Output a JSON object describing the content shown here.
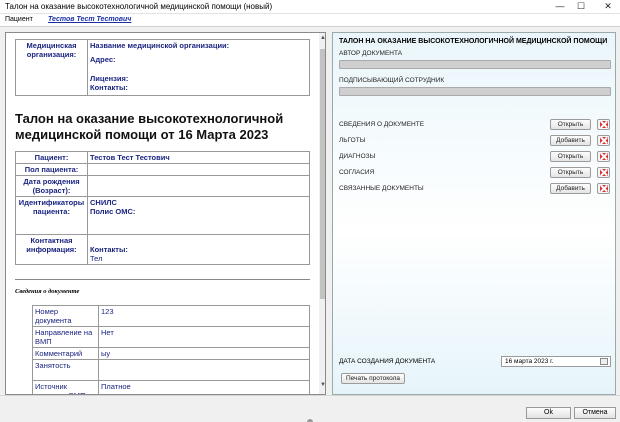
{
  "window": {
    "title": "Талон на оказание высокотехнологичной медицинской помощи (новый)",
    "minimize_glyph": "—",
    "maximize_glyph": "☐",
    "close_glyph": "✕"
  },
  "menubar": {
    "patient_label": "Пациент",
    "patient_name": "Тестов Тест Тестович"
  },
  "document": {
    "org_label": "Медицинская организация:",
    "org_name_label": "Название медицинской организации:",
    "address_label": "Адрес:",
    "license_label": "Лицензия:",
    "contacts_label": "Контакты:",
    "title": "Талон на оказание высокотехнологичной медицинской помощи от 16 Марта 2023",
    "patient_label": "Пациент:",
    "patient_value": "Тестов Тест Тестович",
    "sex_label": "Пол пациента:",
    "birth_label": "Дата рождения (Возраст):",
    "ids_label": "Идентификаторы пациента:",
    "snils_label": "СНИЛС",
    "oms_label": "Полис ОМС:",
    "contact_info_label": "Контактная информация:",
    "contact_contacts_label": "Контакты:",
    "phone_label": "Тел",
    "section_title": "Сведения о документе",
    "details": [
      {
        "label": "Номер документа",
        "value": "123"
      },
      {
        "label": "Направление на ВМП",
        "value": "Нет"
      },
      {
        "label": "Комментарий",
        "value": "ыу"
      },
      {
        "label": "Занятость",
        "value": ""
      },
      {
        "label": "Источник оказания ВМП",
        "value": "Платное"
      }
    ],
    "scroll_up": "▲",
    "scroll_down": "▼"
  },
  "panel": {
    "title": "ТАЛОН НА ОКАЗАНИЕ ВЫСОКОТЕХНОЛОГИЧНОЙ МЕДИЦИНСКОЙ ПОМОЩИ",
    "author_label": "АВТОР ДОКУМЕНТА",
    "signer_label": "ПОДПИСЫВАЮЩИЙ СОТРУДНИК",
    "rows": [
      {
        "label": "СВЕДЕНИЯ О ДОКУМЕНТЕ",
        "button": "Открыть"
      },
      {
        "label": "ЛЬГОТЫ",
        "button": "Добавить"
      },
      {
        "label": "ДИАГНОЗЫ",
        "button": "Открыть"
      },
      {
        "label": "СОГЛАСИЯ",
        "button": "Открыть"
      },
      {
        "label": "СВЯЗАННЫЕ ДОКУМЕНТЫ",
        "button": "Добавить"
      }
    ],
    "date_label": "ДАТА СОЗДАНИЯ ДОКУМЕНТА",
    "date_value": "16   марта    2023 г.",
    "print_button": "Печать протокола"
  },
  "footer": {
    "ok": "Ok",
    "cancel": "Отмена"
  }
}
